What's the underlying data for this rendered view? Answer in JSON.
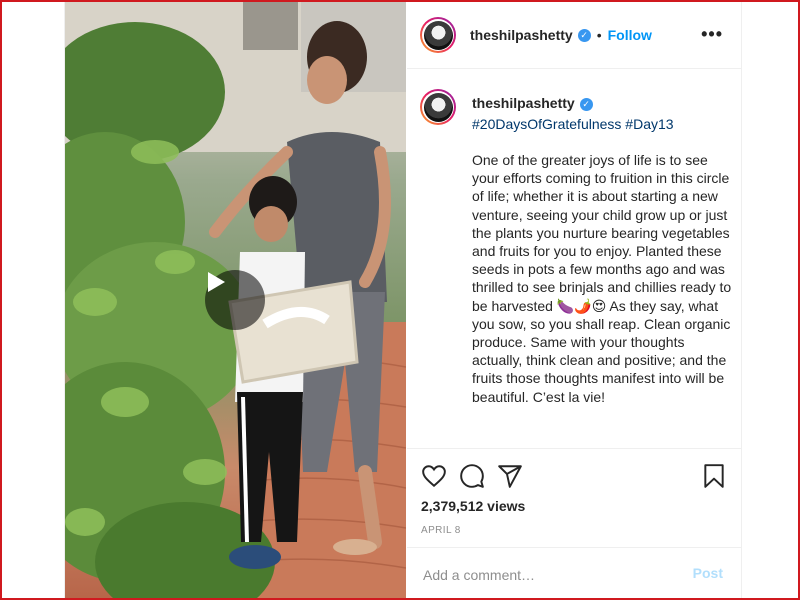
{
  "header": {
    "username": "theshilpashetty",
    "separator": "•",
    "follow_label": "Follow",
    "more_label": "•••"
  },
  "caption": {
    "username": "theshilpashetty",
    "hashtags": "#20DaysOfGratefulness #Day13",
    "text": "One of the greater joys of life is to see your efforts coming to fruition in this circle of life; whether it is about starting a new venture, seeing your child grow up or just the plants you nurture bearing vegetables and fruits for you to enjoy. Planted these seeds in pots a few months ago and was thrilled to see brinjals and chillies ready to be harvested 🍆🌶️😍 As they say, what you sow, so you shall reap. Clean organic produce. Same with your thoughts actually, think clean and positive; and the fruits those thoughts manifest into will be beautiful. C’est la vie!"
  },
  "stats": {
    "views": "2,379,512 views",
    "date": "APRIL 8"
  },
  "comment": {
    "placeholder": "Add a comment…",
    "post_label": "Post"
  },
  "icons": {
    "verified": "verified-badge-icon",
    "like": "heart-icon",
    "comment": "comment-icon",
    "share": "share-icon",
    "save": "bookmark-icon",
    "play": "play-icon"
  },
  "colors": {
    "frame_border": "#d0191f",
    "link_blue": "#0095f6",
    "hashtag": "#00376b",
    "post_disabled": "#b2dffc"
  }
}
